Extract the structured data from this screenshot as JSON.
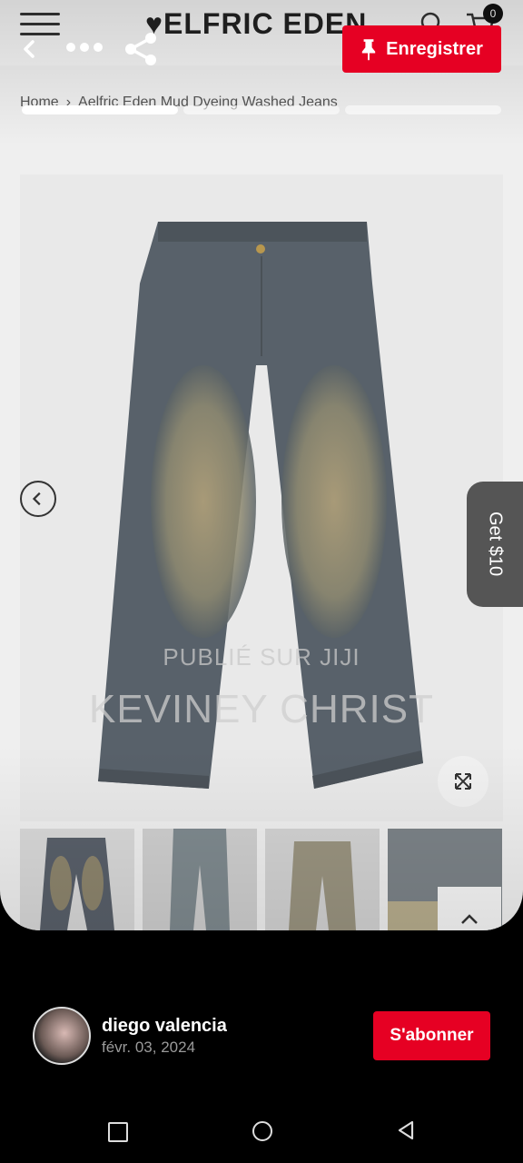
{
  "site": {
    "brand": "ELFRIC EDEN",
    "cart_count": "0",
    "breadcrumb": [
      "Home",
      "Aelfric Eden Mud Dyeing Washed Jeans"
    ]
  },
  "pin": {
    "save_label": "Enregistrer",
    "watermark_line1": "PUBLIÉ SUR JIJI",
    "watermark_line2": "KEVINEY CHRIST",
    "promo_tab": "Get $10",
    "progress": [
      1.0,
      0.0,
      0.0
    ]
  },
  "author": {
    "name": "diego valencia",
    "date": "févr. 03, 2024",
    "follow_label": "S'abonner"
  },
  "colors": {
    "accent": "#e60023",
    "background": "#000000"
  },
  "icons": [
    "menu-icon",
    "search-icon",
    "cart-icon",
    "back-arrow-icon",
    "more-icon",
    "share-icon",
    "pin-icon",
    "chevron-left-icon",
    "expand-icon",
    "chevron-up-icon",
    "nav-recents-icon",
    "nav-home-icon",
    "nav-back-icon"
  ]
}
